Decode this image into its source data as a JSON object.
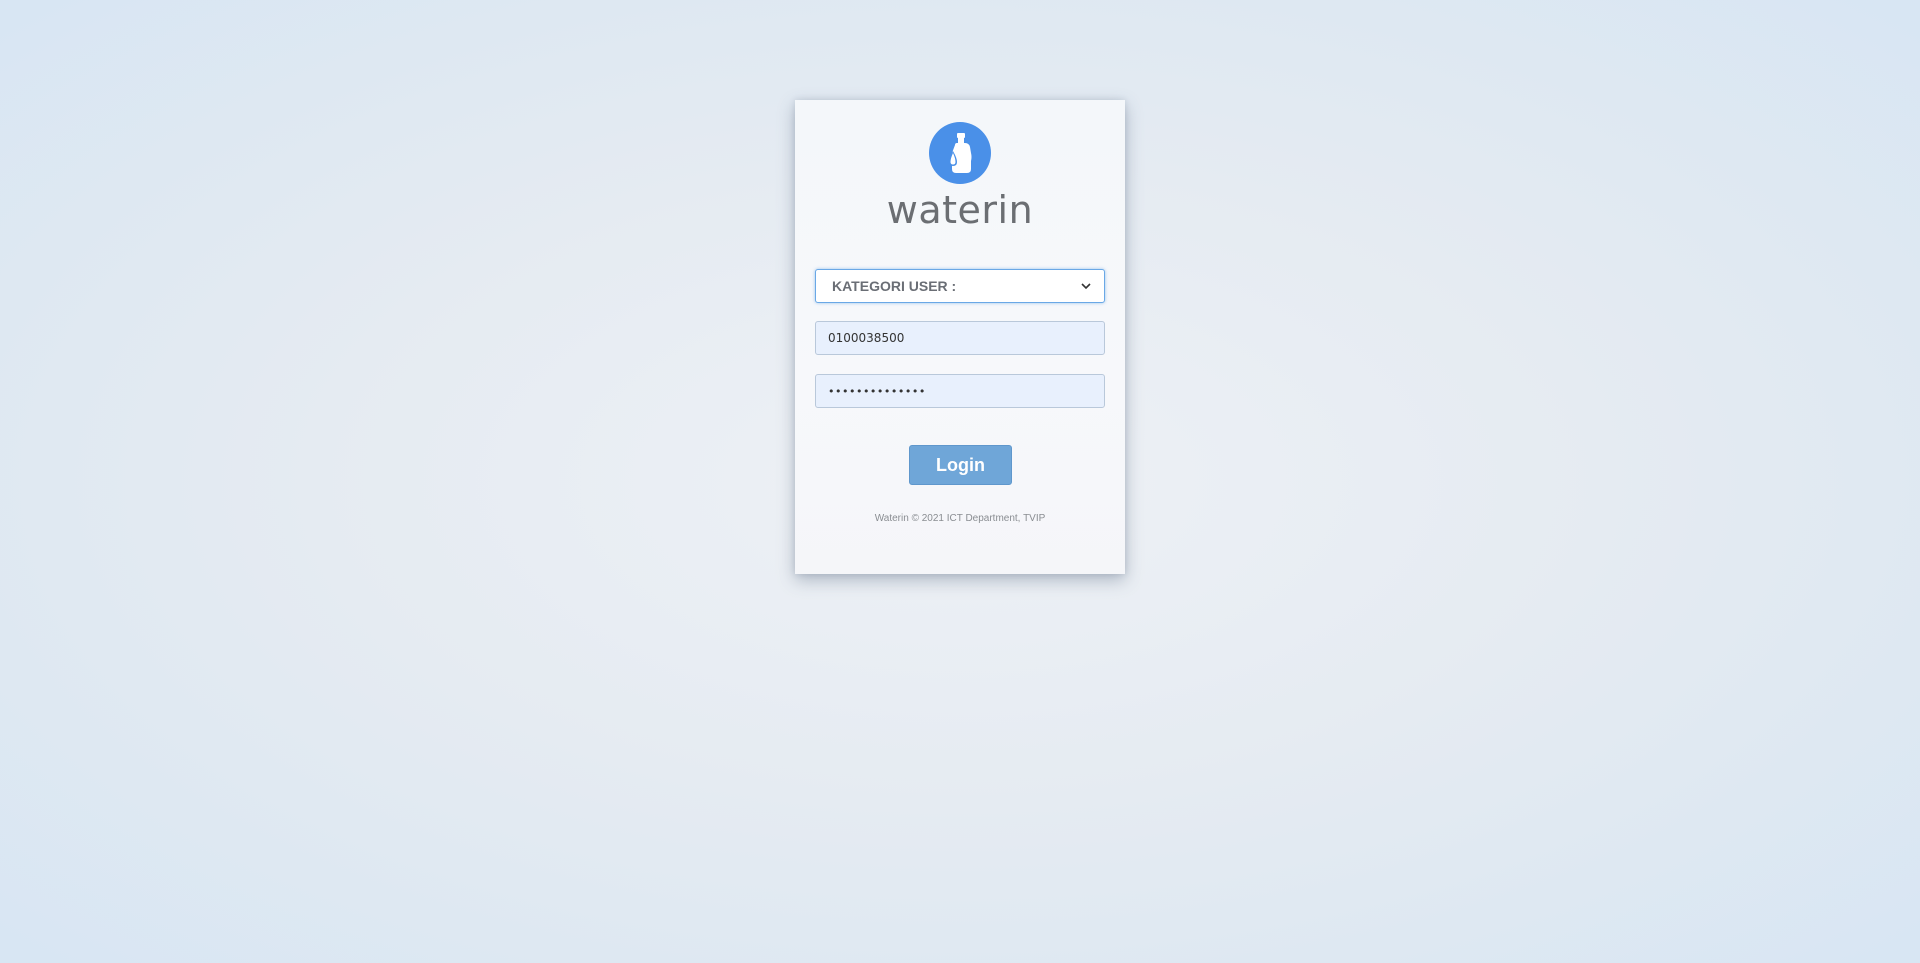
{
  "brand": {
    "logo_icon": "water-bottle-icon",
    "name": "waterin",
    "accent_color": "#4a90e8"
  },
  "login_form": {
    "category_select": {
      "selected": "KATEGORI USER :"
    },
    "username": {
      "value": "0100038500"
    },
    "password": {
      "masked_value": "••••••••••••••"
    },
    "login_label": "Login"
  },
  "footer": {
    "text": "Waterin © 2021 ICT Department, TVIP"
  }
}
